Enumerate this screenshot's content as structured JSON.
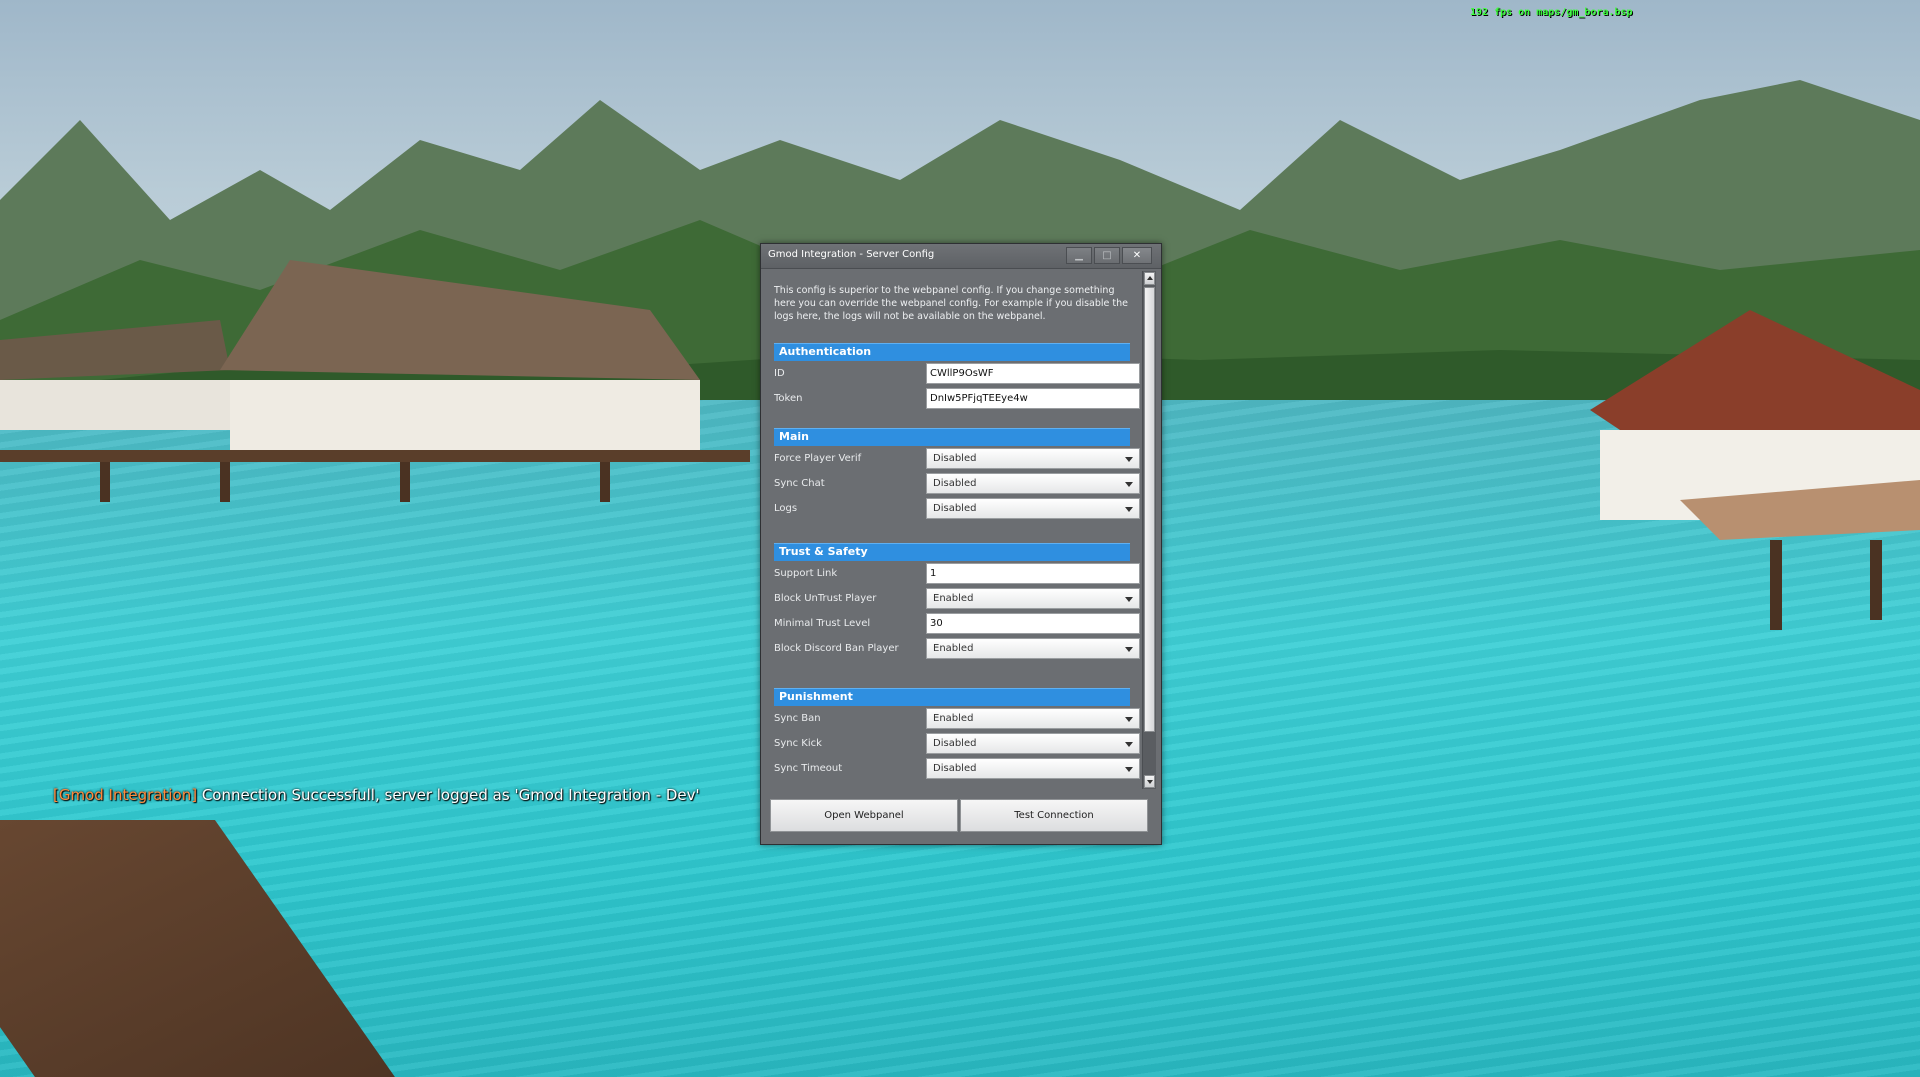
{
  "hud": {
    "fps_text": "192 fps on maps/gm_bora.bsp"
  },
  "chat": {
    "tag": "[Gmod Integration]",
    "message": " Connection Successfull, server logged as 'Gmod Integration - Dev'"
  },
  "window": {
    "title": "Gmod Integration - Server Config",
    "intro": "This config is superior to the webpanel config. If you change something here you can override the webpanel config. For example if you disable the logs here, the logs will not be available on the webpanel.",
    "sections": {
      "authentication": {
        "header": "Authentication",
        "id_label": "ID",
        "id_value": "CWllP9OsWF",
        "token_label": "Token",
        "token_value": "DnIw5PFjqTEEye4w"
      },
      "main": {
        "header": "Main",
        "force_player_verif_label": "Force Player Verif",
        "force_player_verif_value": "Disabled",
        "sync_chat_label": "Sync Chat",
        "sync_chat_value": "Disabled",
        "logs_label": "Logs",
        "logs_value": "Disabled"
      },
      "trust_safety": {
        "header": "Trust & Safety",
        "support_link_label": "Support Link",
        "support_link_value": "1",
        "block_untrust_player_label": "Block UnTrust Player",
        "block_untrust_player_value": "Enabled",
        "minimal_trust_level_label": "Minimal Trust Level",
        "minimal_trust_level_value": "30",
        "block_discord_ban_player_label": "Block Discord Ban Player",
        "block_discord_ban_player_value": "Enabled"
      },
      "punishment": {
        "header": "Punishment",
        "sync_ban_label": "Sync Ban",
        "sync_ban_value": "Enabled",
        "sync_kick_label": "Sync Kick",
        "sync_kick_value": "Disabled",
        "sync_timeout_label": "Sync Timeout",
        "sync_timeout_value": "Disabled"
      }
    },
    "buttons": {
      "open_webpanel": "Open Webpanel",
      "test_connection": "Test Connection"
    }
  },
  "colors": {
    "section_header": "#2f8fe0",
    "window_bg": "#6b6e72",
    "fps_text": "#3cff3c",
    "chat_tag": "#ff8a3c"
  }
}
